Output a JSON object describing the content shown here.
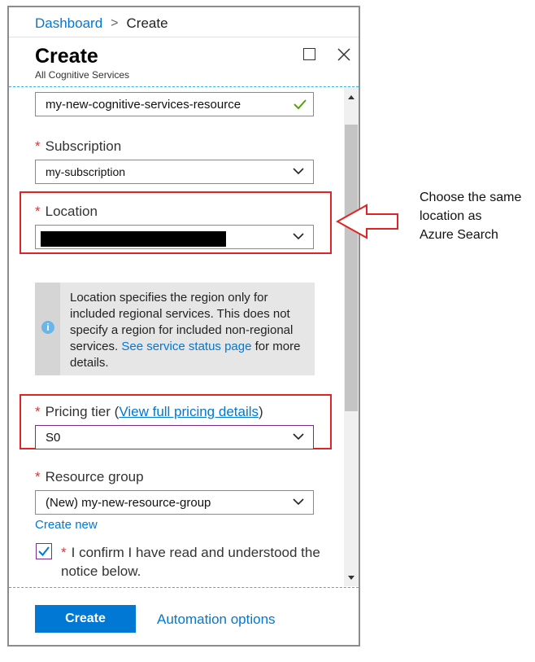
{
  "breadcrumb": {
    "root": "Dashboard",
    "separator": ">",
    "current": "Create"
  },
  "blade": {
    "title": "Create",
    "subtitle": "All Cognitive Services"
  },
  "form": {
    "name_value": "my-new-cognitive-services-resource",
    "subscription": {
      "required_mark": "*",
      "label": "Subscription",
      "value": "my-subscription"
    },
    "location": {
      "required_mark": "*",
      "label": "Location",
      "value": ""
    },
    "info": {
      "text_before": "Location specifies the region only for included regional services. This does not specify a region for included non-regional services.",
      "link_text": "See service status page",
      "text_after": "for more details."
    },
    "pricing": {
      "required_mark": "*",
      "label": "Pricing tier",
      "paren_open": "(",
      "link_text": "View full pricing details",
      "paren_close": ")",
      "value": "S0"
    },
    "resource_group": {
      "required_mark": "*",
      "label": "Resource group",
      "value": "(New) my-new-resource-group",
      "create_new": "Create new"
    },
    "confirm": {
      "checked": true,
      "required_mark": "*",
      "text": "I confirm I have read and understood the notice below."
    }
  },
  "footer": {
    "create_label": "Create",
    "automation_label": "Automation options"
  },
  "annotation": {
    "lines": [
      "Choose the same",
      "location as",
      "Azure Search"
    ]
  },
  "colors": {
    "accent": "#0078d4",
    "required": "#d93535",
    "highlight_border": "#e02424",
    "valid_check": "#57a300"
  }
}
